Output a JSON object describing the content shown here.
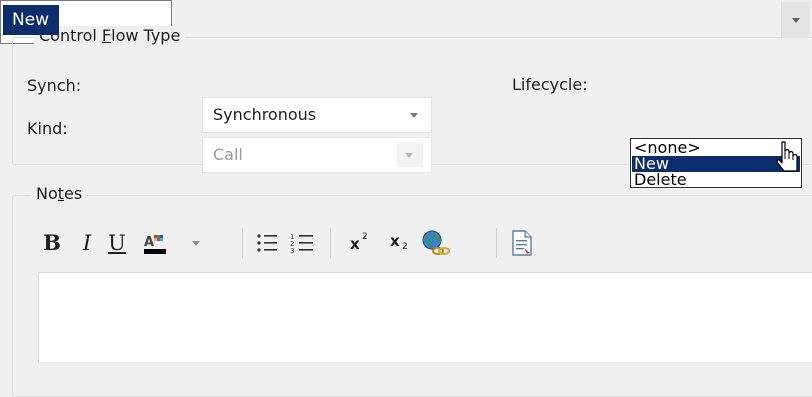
{
  "control_flow_group": {
    "title_before": "Control ",
    "title_underlined": "F",
    "title_after": "low Type"
  },
  "synch": {
    "label": "Synch:",
    "value": "Synchronous"
  },
  "kind": {
    "label": "Kind:",
    "value": "Call"
  },
  "lifecycle": {
    "label": "Lifecycle:",
    "value": "New",
    "options": [
      "<none>",
      "New",
      "Delete"
    ],
    "selected_option": "New"
  },
  "notes_group": {
    "title_before": "No",
    "title_underlined": "t",
    "title_after": "es"
  },
  "toolbar": {
    "bold": "B",
    "italic": "I",
    "underline": "U",
    "superscript_base": "x",
    "superscript_exp": "2",
    "subscript_base": "x",
    "subscript_idx": "2",
    "icons": [
      "bold-icon",
      "italic-icon",
      "underline-icon",
      "font-color-icon",
      "bulleted-list-icon",
      "numbered-list-icon",
      "superscript-icon",
      "subscript-icon",
      "hyperlink-icon",
      "document-icon"
    ]
  },
  "colors": {
    "window_bg": "#f0f0f0",
    "selection": "#0c2d6b",
    "border": "#dcdcdc"
  },
  "notes_text": ""
}
